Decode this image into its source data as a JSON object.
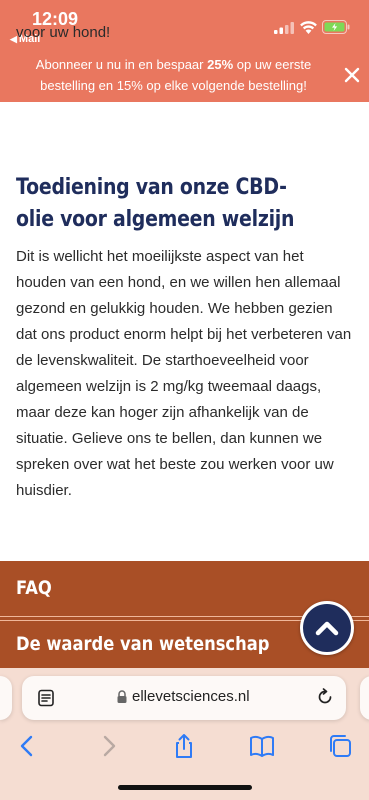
{
  "status_bar": {
    "time": "12:09",
    "back_app": "Mail"
  },
  "banner": {
    "text_before": "Abonneer u nu in en bespaar ",
    "highlight": "25%",
    "text_after": " op uw eerste bestelling en 15% op elke volgende bestelling!",
    "close_icon": "close-icon"
  },
  "article": {
    "intro_tail": "voor uw hond!",
    "section_title": "Toediening van onze CBD-olie voor algemeen welzijn",
    "paragraph": "Dit is wellicht het moeilijkste aspect van het houden van een hond, en we willen hen allemaal gezond en gelukkig houden. We hebben gezien dat ons product enorm helpt bij het verbeteren van de levenskwaliteit. De starthoeveelheid voor algemeen welzijn is 2 mg/kg tweemaal daags, maar deze kan hoger zijn afhankelijk van de situatie. Gelieve ons te bellen, dan kunnen we spreken over wat het beste zou werken voor uw huisdier."
  },
  "faq": {
    "items": [
      "FAQ",
      "De waarde van wetenschap"
    ]
  },
  "browser": {
    "url": "ellevetsciences.nl",
    "icons": [
      "reader-icon",
      "lock-icon",
      "reload-icon",
      "back-icon",
      "forward-icon",
      "share-icon",
      "bookmarks-icon",
      "tabs-icon"
    ]
  },
  "colors": {
    "banner_bg": "#e9775f",
    "heading": "#1f2d5c",
    "faq_band": "#a94f26",
    "toolbar_bg": "#f5ddd2",
    "accent_blue": "#2f7bf6"
  }
}
